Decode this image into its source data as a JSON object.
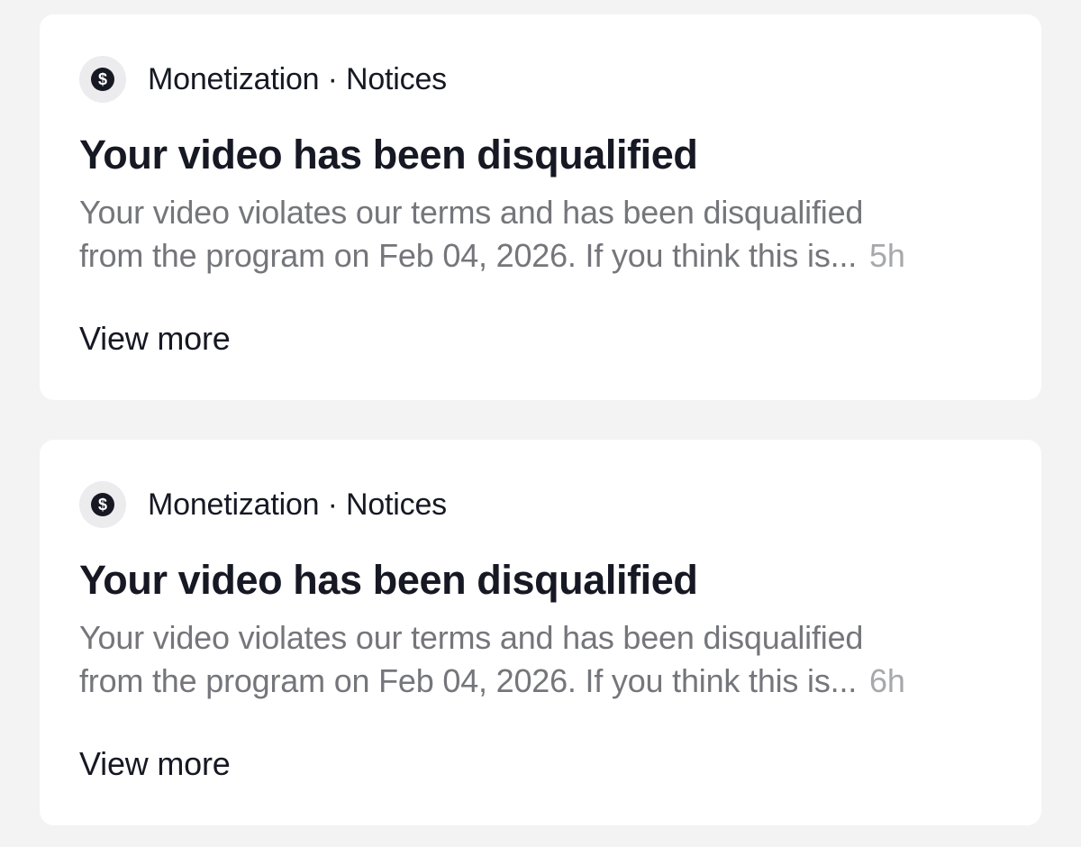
{
  "notifications": [
    {
      "category": "Monetization · Notices",
      "icon": "dollar-icon",
      "title": "Your video has been disqualified",
      "body_line1": "Your video violates our terms and has been disqualified",
      "body_line2": "from the program on Feb 04, 2026. If you think this is...",
      "timestamp": "5h",
      "action_label": "View more"
    },
    {
      "category": "Monetization · Notices",
      "icon": "dollar-icon",
      "title": "Your video has been disqualified",
      "body_line1": "Your video violates our terms and has been disqualified",
      "body_line2": "from the program on Feb 04, 2026. If you think this is...",
      "timestamp": "6h",
      "action_label": "View more"
    }
  ],
  "colors": {
    "background": "#f3f3f3",
    "card": "#ffffff",
    "primary_text": "#161823",
    "secondary_text": "#75767b",
    "timestamp_text": "#a7a8ac",
    "icon_circle": "#ececef"
  }
}
